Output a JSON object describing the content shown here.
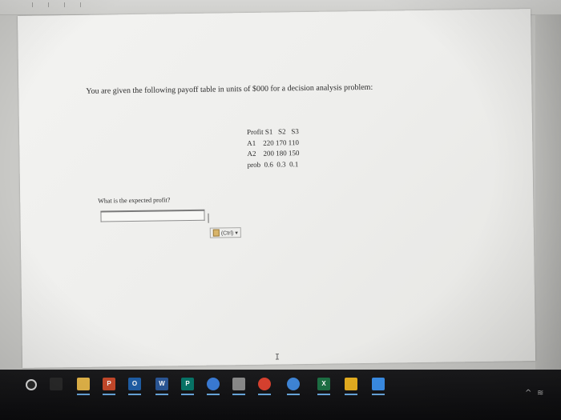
{
  "document": {
    "problem_text": "You are given the following payoff table in units of $000 for a decision analysis problem:",
    "payoff_table": {
      "rows": [
        "Profit S1   S2   S3",
        "A1    220 170 110",
        "A2    200 180 150",
        "prob  0.6  0.3  0.1"
      ]
    },
    "question": "What is the expected profit?",
    "answer_value": "",
    "paste_options_label": "(Ctrl) ▾"
  },
  "taskbar": {
    "apps": [
      {
        "name": "start",
        "label": "",
        "color": "#2a2a2a"
      },
      {
        "name": "task-view",
        "label": "",
        "color": "#2a2a2a"
      },
      {
        "name": "file-explorer",
        "label": "",
        "color": "#e8b84a"
      },
      {
        "name": "powerpoint",
        "label": "P",
        "color": "#c94a2b"
      },
      {
        "name": "outlook",
        "label": "O",
        "color": "#1f5fa8"
      },
      {
        "name": "word",
        "label": "W",
        "color": "#2b5797"
      },
      {
        "name": "publisher",
        "label": "P",
        "color": "#077568"
      },
      {
        "name": "app-blue",
        "label": "",
        "color": "#3a7bd5"
      },
      {
        "name": "app-gray",
        "label": "",
        "color": "#8a8a8a"
      },
      {
        "name": "chrome",
        "label": "",
        "color": "#d9412f"
      },
      {
        "name": "app-circle",
        "label": "",
        "color": "#3f86d8"
      },
      {
        "name": "excel",
        "label": "X",
        "color": "#1d7044"
      },
      {
        "name": "sticky-notes",
        "label": "",
        "color": "#e8b020"
      },
      {
        "name": "app-edge",
        "label": "",
        "color": "#3b8ee8"
      }
    ]
  }
}
